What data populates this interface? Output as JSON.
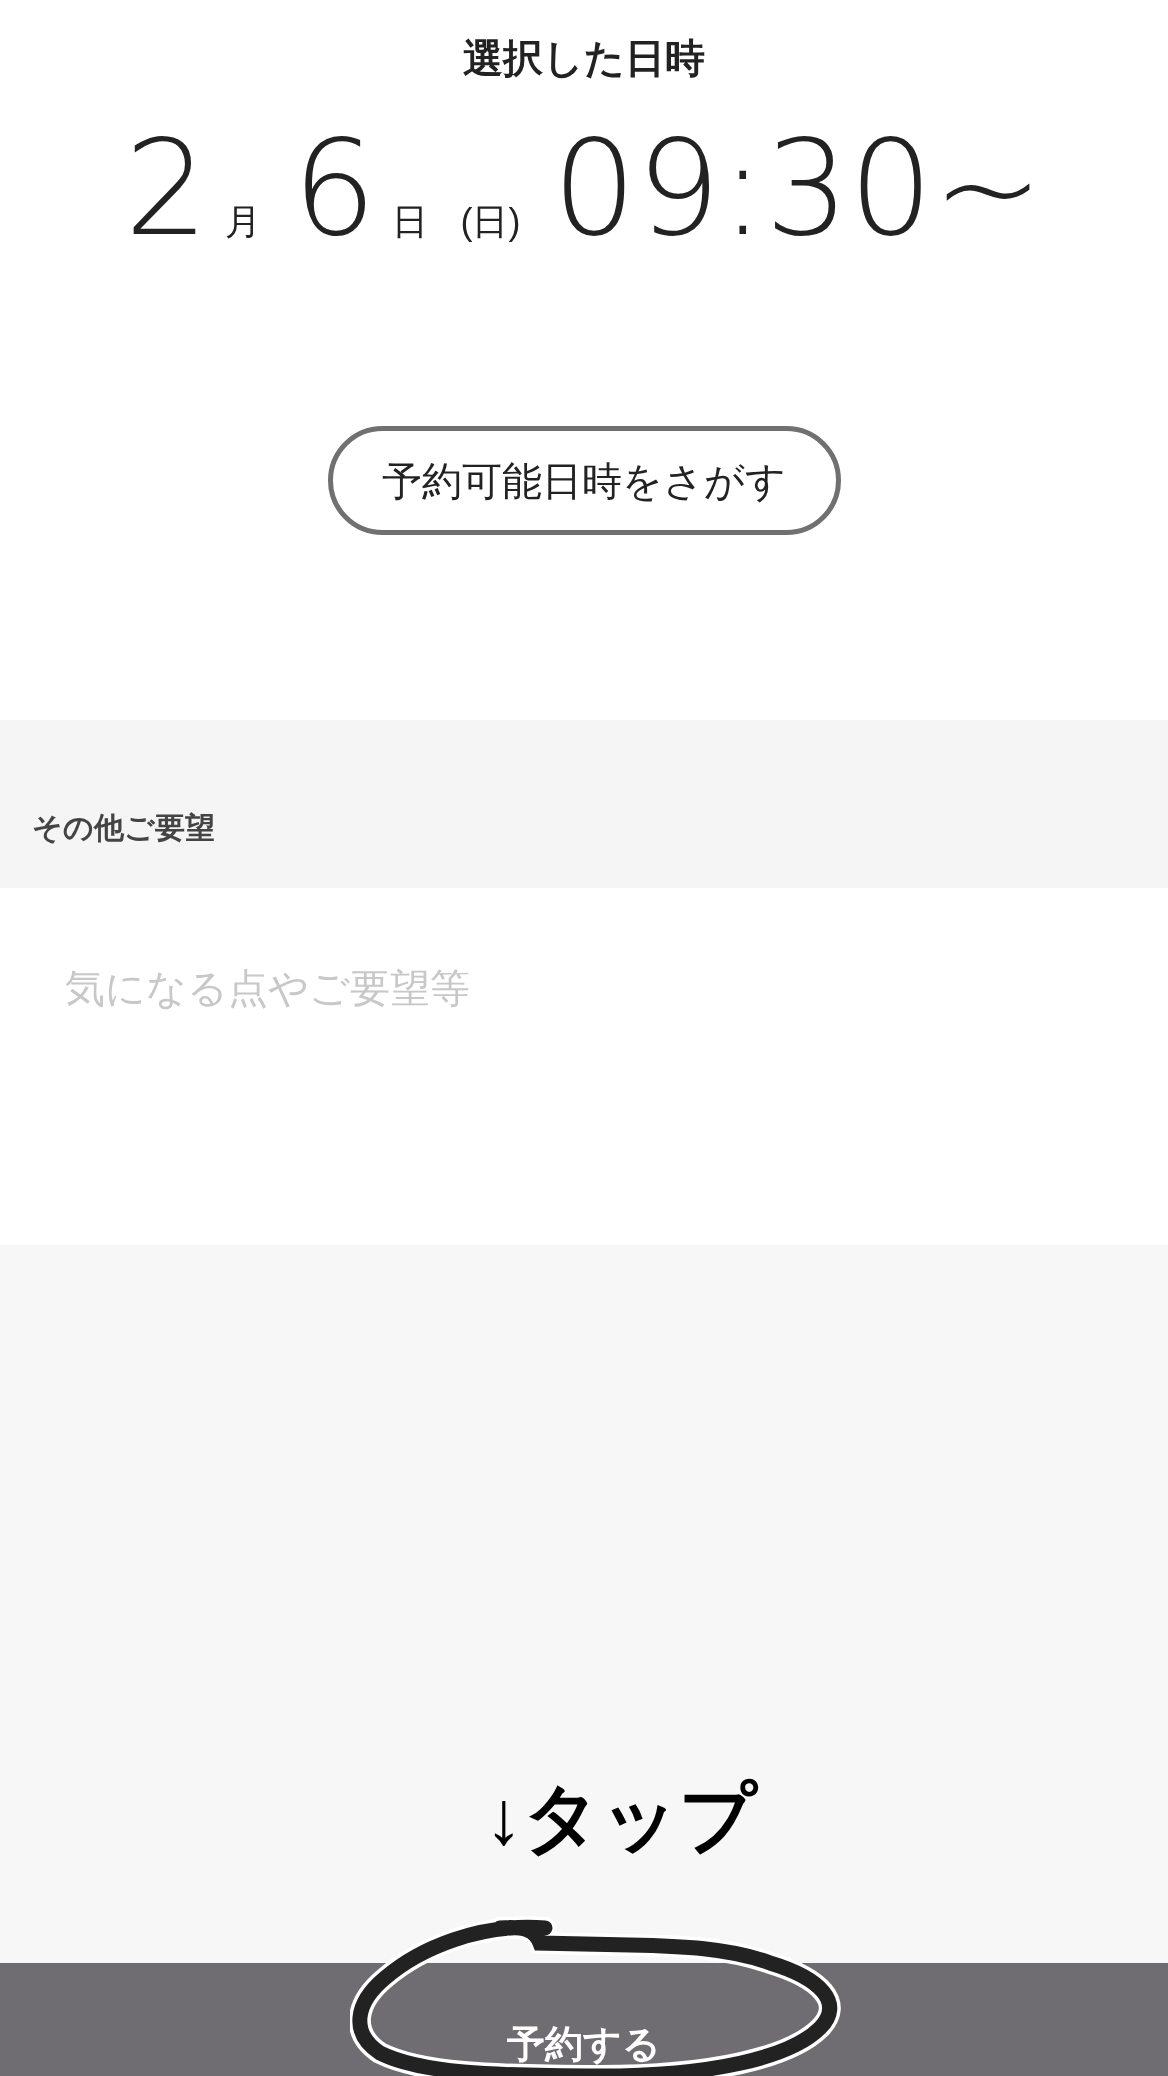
{
  "selected_datetime": {
    "heading": "選択した日時",
    "month": "2",
    "month_unit": "月",
    "day": "6",
    "day_unit": "日",
    "weekday": "(日)",
    "time": "09:30~"
  },
  "search_button": {
    "label": "予約可能日時をさがす"
  },
  "notes": {
    "label": "その他ご要望",
    "placeholder": "気になる点やご要望等"
  },
  "annotation": {
    "text": "↓タップ"
  },
  "submit_button": {
    "label": "予約する"
  }
}
